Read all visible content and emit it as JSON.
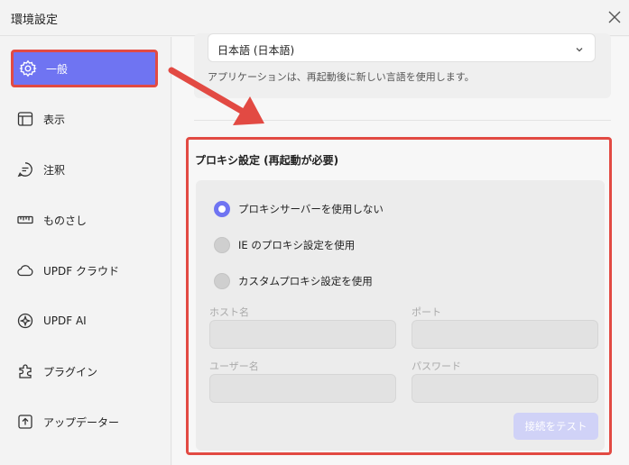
{
  "window": {
    "title": "環境設定"
  },
  "sidebar": {
    "items": [
      {
        "label": "一般",
        "icon": "gear-icon",
        "active": true
      },
      {
        "label": "表示",
        "icon": "display-icon",
        "active": false
      },
      {
        "label": "注釈",
        "icon": "comment-icon",
        "active": false
      },
      {
        "label": "ものさし",
        "icon": "ruler-icon",
        "active": false
      },
      {
        "label": "UPDF クラウド",
        "icon": "cloud-icon",
        "active": false
      },
      {
        "label": "UPDF AI",
        "icon": "ai-icon",
        "active": false
      },
      {
        "label": "プラグイン",
        "icon": "plugin-icon",
        "active": false
      },
      {
        "label": "アップデーター",
        "icon": "update-icon",
        "active": false
      }
    ]
  },
  "language": {
    "selected": "日本語 (日本語)",
    "note": "アプリケーションは、再起動後に新しい言語を使用します。"
  },
  "proxy": {
    "title": "プロキシ設定 (再起動が必要)",
    "options": [
      {
        "label": "プロキシサーバーを使用しない",
        "checked": true
      },
      {
        "label": "IE のプロキシ設定を使用",
        "checked": false
      },
      {
        "label": "カスタムプロキシ設定を使用",
        "checked": false
      }
    ],
    "host_label": "ホスト名",
    "port_label": "ポート",
    "user_label": "ユーザー名",
    "password_label": "パスワード",
    "test_button": "接続をテスト"
  },
  "colors": {
    "accent": "#6f74f2",
    "highlight": "#e24a43",
    "disabled_button": "#d0d2f7"
  }
}
